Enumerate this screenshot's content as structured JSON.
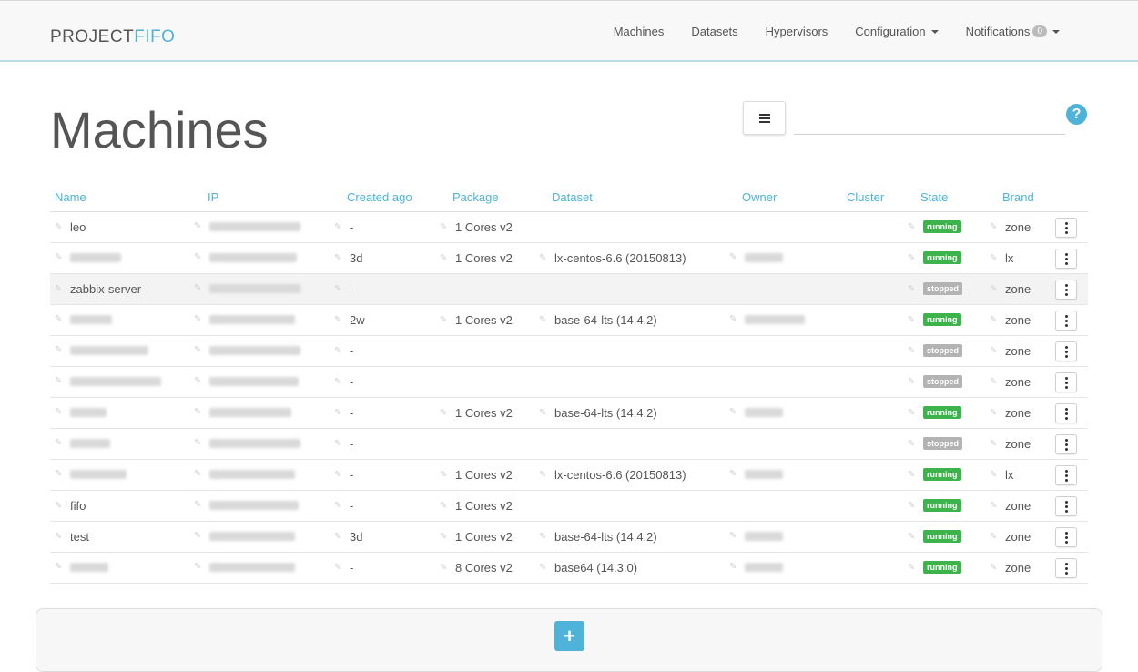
{
  "brand": {
    "part1": "PROJECT",
    "part2": "FIFO"
  },
  "nav": {
    "machines": "Machines",
    "datasets": "Datasets",
    "hypervisors": "Hypervisors",
    "configuration": "Configuration",
    "notifications": "Notifications",
    "notifications_count": "0"
  },
  "page": {
    "title": "Machines",
    "search_value": "",
    "help": "?"
  },
  "table": {
    "headers": {
      "name": "Name",
      "ip": "IP",
      "created": "Created ago",
      "package": "Package",
      "dataset": "Dataset",
      "owner": "Owner",
      "cluster": "Cluster",
      "state": "State",
      "brand": "Brand"
    },
    "rows": [
      {
        "name": "leo",
        "created": "-",
        "package": "1 Cores v2",
        "dataset": "",
        "state": "running",
        "brand": "zone"
      },
      {
        "name": "",
        "created": "3d",
        "package": "1 Cores v2",
        "dataset": "lx-centos-6.6 (20150813)",
        "state": "running",
        "brand": "lx"
      },
      {
        "name": "zabbix-server",
        "created": "-",
        "package": "",
        "dataset": "",
        "state": "stopped",
        "brand": "zone"
      },
      {
        "name": "",
        "created": "2w",
        "package": "1 Cores v2",
        "dataset": "base-64-lts (14.4.2)",
        "state": "running",
        "brand": "zone"
      },
      {
        "name": "",
        "created": "-",
        "package": "",
        "dataset": "",
        "state": "stopped",
        "brand": "zone"
      },
      {
        "name": "",
        "created": "-",
        "package": "",
        "dataset": "",
        "state": "stopped",
        "brand": "zone"
      },
      {
        "name": "",
        "created": "-",
        "package": "1 Cores v2",
        "dataset": "base-64-lts (14.4.2)",
        "state": "running",
        "brand": "zone"
      },
      {
        "name": "",
        "created": "-",
        "package": "",
        "dataset": "",
        "state": "stopped",
        "brand": "zone"
      },
      {
        "name": "",
        "created": "-",
        "package": "1 Cores v2",
        "dataset": "lx-centos-6.6 (20150813)",
        "state": "running",
        "brand": "lx"
      },
      {
        "name": "fifo",
        "created": "-",
        "package": "1 Cores v2",
        "dataset": "",
        "state": "running",
        "brand": "zone"
      },
      {
        "name": "test",
        "created": "3d",
        "package": "1 Cores v2",
        "dataset": "base-64-lts (14.4.2)",
        "state": "running",
        "brand": "zone"
      },
      {
        "name": "",
        "created": "-",
        "package": "8 Cores v2",
        "dataset": "base64 (14.3.0)",
        "state": "running",
        "brand": "zone"
      }
    ]
  },
  "add_button": "+",
  "colors": {
    "accent": "#4fb3d9",
    "running": "#3cb44b",
    "stopped": "#b3b3b3"
  }
}
